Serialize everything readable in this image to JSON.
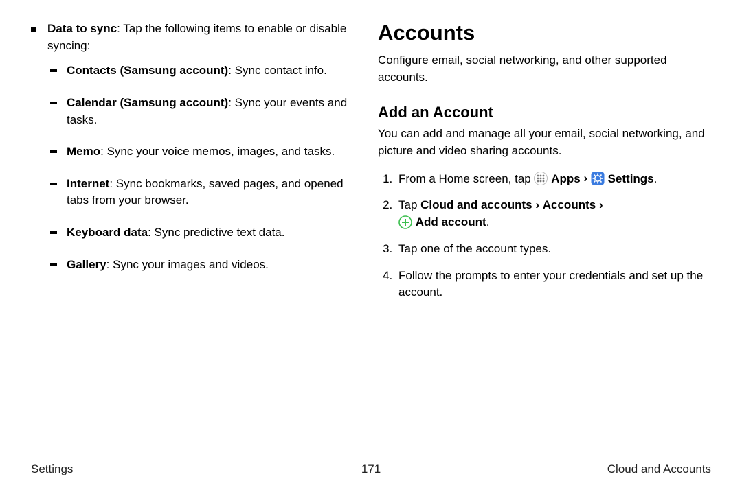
{
  "left": {
    "intro_bold": "Data to sync",
    "intro_rest": ": Tap the following items to enable or disable syncing:",
    "items": [
      {
        "bold": "Contacts (Samsung account)",
        "rest": ": Sync contact info."
      },
      {
        "bold": "Calendar (Samsung account)",
        "rest": ": Sync your events and tasks."
      },
      {
        "bold": "Memo",
        "rest": ": Sync your voice memos, images, and tasks."
      },
      {
        "bold": "Internet",
        "rest": ": Sync bookmarks, saved pages, and opened tabs from your browser."
      },
      {
        "bold": "Keyboard data",
        "rest": ": Sync predictive text data."
      },
      {
        "bold": "Gallery",
        "rest": ": Sync your images and videos."
      }
    ]
  },
  "right": {
    "heading": "Accounts",
    "intro": "Configure email, social networking, and other supported accounts.",
    "sub_heading": "Add an Account",
    "sub_intro": "You can add and manage all your email, social networking, and picture and video sharing accounts.",
    "step1_pre": "From a Home screen, tap ",
    "step1_apps": "Apps",
    "step1_settings": "Settings",
    "step2_pre": "Tap ",
    "step2_path1": "Cloud and accounts",
    "step2_path2": "Accounts",
    "step2_add": "Add account",
    "step3": "Tap one of the account types.",
    "step4": "Follow the prompts to enter your credentials and set up the account.",
    "chevron": "›",
    "period": "."
  },
  "footer": {
    "left": "Settings",
    "center": "171",
    "right": "Cloud and Accounts"
  }
}
